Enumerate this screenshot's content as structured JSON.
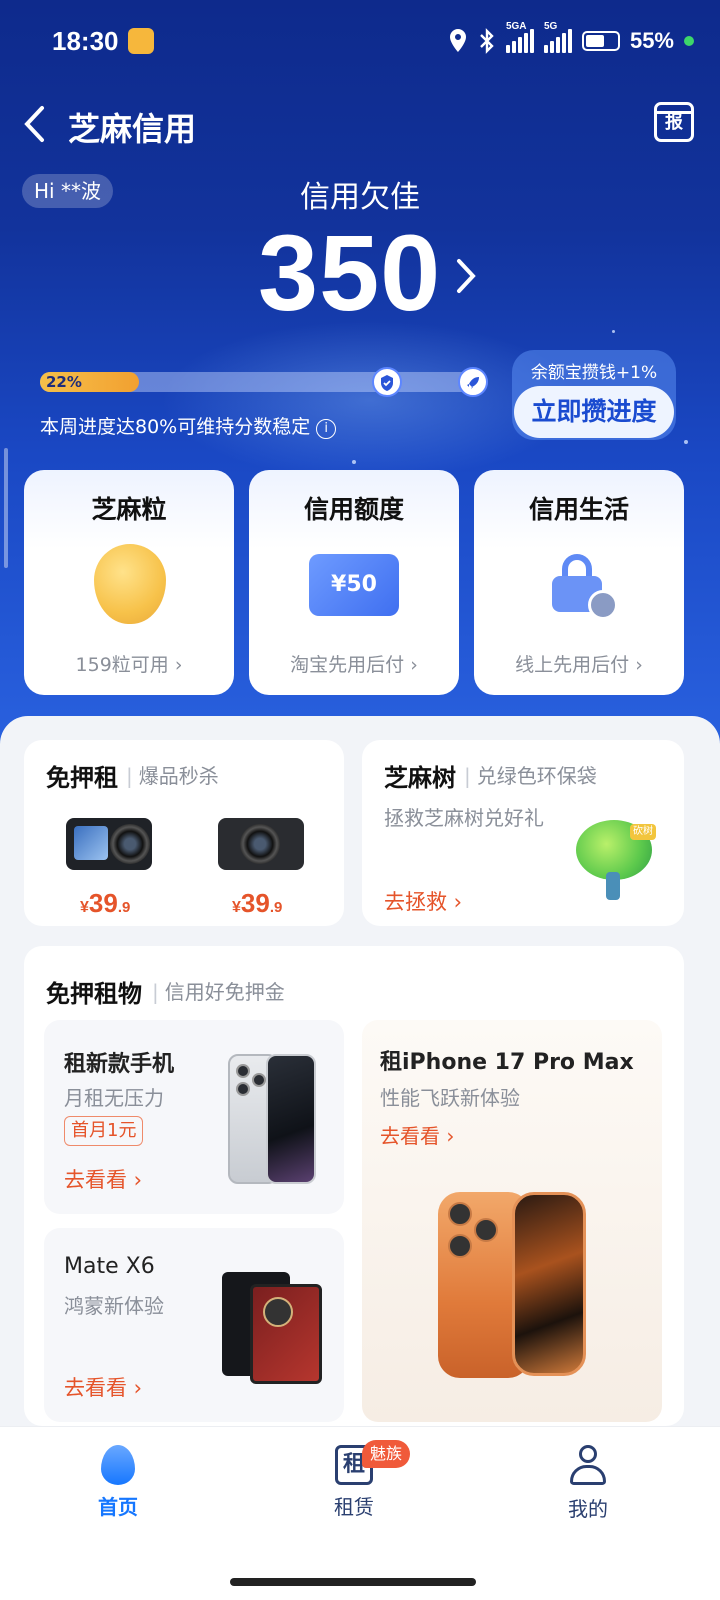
{
  "status_bar": {
    "time": "18:30",
    "net1": "5GA",
    "net2": "5G",
    "battery": "55%"
  },
  "header": {
    "title": "芝麻信用",
    "calendar_label": "报"
  },
  "user": {
    "greeting": "Hi **波"
  },
  "credit": {
    "level": "信用欠佳",
    "score": "350",
    "progress_percent": 22,
    "progress_label": "22%",
    "progress_note": "本周进度达80%可维持分数稳定",
    "promo": "余额宝攒钱+1%",
    "boost_button": "立即攒进度"
  },
  "quick_cards": [
    {
      "title": "芝麻粒",
      "subtitle": "159粒可用 ›"
    },
    {
      "title": "信用额度",
      "voucher": "¥50",
      "subtitle": "淘宝先用后付 ›"
    },
    {
      "title": "信用生活",
      "subtitle": "线上先用后付 ›"
    }
  ],
  "deposit_free": {
    "title": "免押租",
    "subtitle": "爆品秒杀",
    "items": [
      {
        "name": "action-camera",
        "price_int": "39",
        "price_dec": ".9"
      },
      {
        "name": "compact-camera",
        "price_int": "39",
        "price_dec": ".9"
      }
    ]
  },
  "sesame_tree": {
    "title": "芝麻树",
    "subtitle": "兑绿色环保袋",
    "desc": "拯救芝麻树兑好礼",
    "link": "去拯救 ›",
    "tree_tag": "砍树"
  },
  "rent_section": {
    "title": "免押租物",
    "subtitle": "信用好免押金",
    "card1": {
      "title": "租新款手机",
      "sub": "月租无压力",
      "tag": "首月1元",
      "link": "去看看 ›"
    },
    "card2": {
      "title": "Mate X6",
      "sub": "鸿蒙新体验",
      "link": "去看看 ›"
    },
    "card3": {
      "title": "租iPhone 17 Pro Max",
      "sub": "性能飞跃新体验",
      "link": "去看看 ›"
    }
  },
  "bottom_nav": {
    "items": [
      {
        "label": "首页",
        "active": true
      },
      {
        "label": "租赁",
        "icon_text": "租",
        "badge": "魅族"
      },
      {
        "label": "我的"
      }
    ],
    "active_color": "#1677ff",
    "inactive_color": "#2a3f70"
  }
}
